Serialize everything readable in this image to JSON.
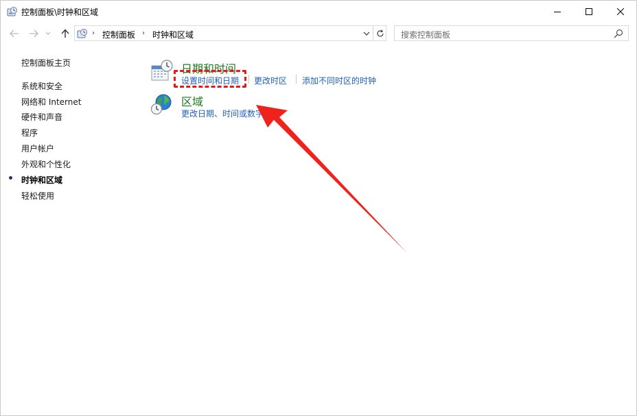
{
  "window": {
    "title": "控制面板\\时钟和区域",
    "icon": "control-panel-icon"
  },
  "address": {
    "crumbs": [
      "控制面板",
      "时钟和区域"
    ],
    "search_placeholder": "搜索控制面板"
  },
  "sidebar": {
    "home": "控制面板主页",
    "items": [
      {
        "label": "系统和安全"
      },
      {
        "label": "网络和 Internet"
      },
      {
        "label": "硬件和声音"
      },
      {
        "label": "程序"
      },
      {
        "label": "用户帐户"
      },
      {
        "label": "外观和个性化"
      },
      {
        "label": "时钟和区域",
        "current": true
      },
      {
        "label": "轻松使用"
      }
    ]
  },
  "categories": [
    {
      "title": "日期和时间",
      "icon": "calendar-clock-icon",
      "links": [
        "设置时间和日期",
        "更改时区",
        "添加不同时区的时钟"
      ]
    },
    {
      "title": "区域",
      "icon": "globe-clock-icon",
      "links": [
        "更改日期、时间或数字格式"
      ]
    }
  ],
  "colors": {
    "category_title": "#1e7a1e",
    "link": "#1f5fbf",
    "annotation": "#e81818"
  }
}
